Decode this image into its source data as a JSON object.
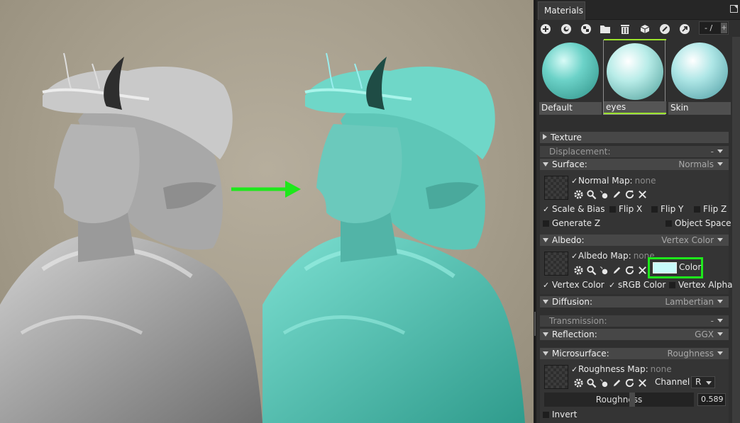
{
  "panel": {
    "tab_label": "Materials",
    "pager": "- /",
    "toolbar_icons": [
      "add-icon",
      "duplicate-icon",
      "checker-icon",
      "folder-icon",
      "trash-icon",
      "cube-icon",
      "pick-icon",
      "export-icon"
    ],
    "materials": [
      {
        "name": "Default",
        "selected": false,
        "color": "#6cd2c8"
      },
      {
        "name": "eyes",
        "selected": true,
        "color": "#b8ece8"
      },
      {
        "name": "Skin",
        "selected": false,
        "color": "#aee6e6"
      }
    ]
  },
  "sections": {
    "texture": {
      "label": "Texture"
    },
    "displacement": {
      "label": "Displacement:",
      "value": "-"
    },
    "surface": {
      "label": "Surface:",
      "value": "Normals",
      "map_label": "Normal Map:",
      "map_value": "none",
      "options": [
        "Scale & Bias",
        "Flip X",
        "Flip Y",
        "Flip Z",
        "Generate Z",
        "Object Space"
      ]
    },
    "albedo": {
      "label": "Albedo:",
      "value": "Vertex Color",
      "map_label": "Albedo Map:",
      "map_value": "none",
      "color_label": "Color",
      "color_hex": "#c8fbfa",
      "options": [
        "Vertex Color",
        "sRGB Color",
        "Vertex Alpha"
      ]
    },
    "diffusion": {
      "label": "Diffusion:",
      "value": "Lambertian"
    },
    "transmission": {
      "label": "Transmission:",
      "value": "-"
    },
    "reflection": {
      "label": "Reflection:",
      "value": "GGX"
    },
    "microsurface": {
      "label": "Microsurface:",
      "value": "Roughness",
      "map_label": "Roughness Map:",
      "map_value": "none",
      "channel_label": "Channel",
      "channel_value": "R",
      "slider_label": "Roughness",
      "slider_value": "0.589",
      "invert_label": "Invert"
    }
  },
  "colors": {
    "accent_green": "#1ee81b",
    "selection_green": "#9be32c",
    "teal_model": "#4ec4b4",
    "gray_model": "#9d9d9d"
  }
}
